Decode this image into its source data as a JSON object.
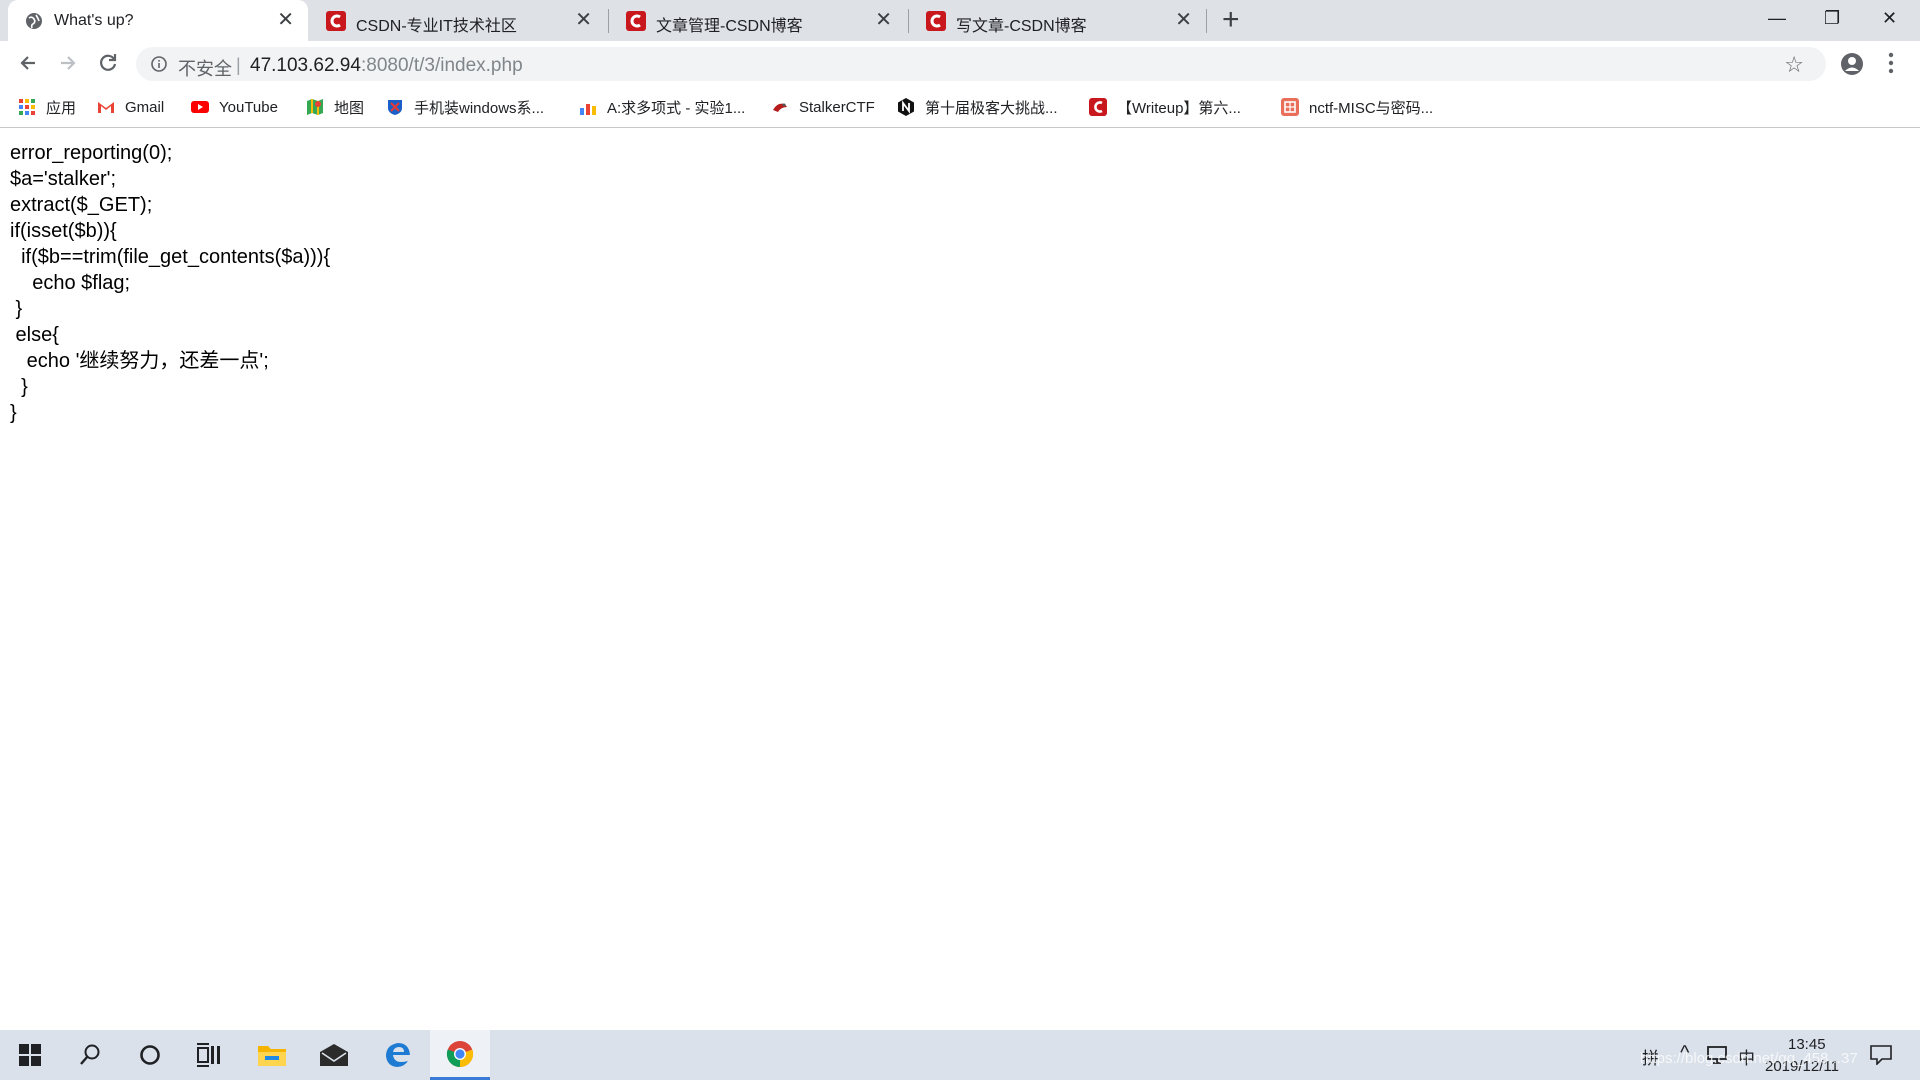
{
  "browser": {
    "tabs": [
      {
        "title": "What's up?",
        "icon": "globe-icon",
        "active": true
      },
      {
        "title": "CSDN-专业IT技术社区",
        "icon": "csdn-icon",
        "active": false
      },
      {
        "title": "文章管理-CSDN博客",
        "icon": "csdn-icon",
        "active": false
      },
      {
        "title": "写文章-CSDN博客",
        "icon": "csdn-icon",
        "active": false
      }
    ],
    "tab_close_glyph": "✕",
    "new_tab_glyph": "+",
    "window_controls": {
      "minimize": "—",
      "maximize": "❐",
      "close": "✕"
    },
    "address": {
      "security_label": "不安全",
      "separator": "|",
      "host": "47.103.62.94",
      "rest": ":8080/t/3/index.php"
    },
    "bookmark_star_glyph": "☆",
    "bookmarks": [
      {
        "label": "应用",
        "icon": "apps-grid-icon"
      },
      {
        "label": "Gmail",
        "icon": "gmail-icon"
      },
      {
        "label": "YouTube",
        "icon": "youtube-icon"
      },
      {
        "label": "地图",
        "icon": "maps-icon"
      },
      {
        "label": "手机装windows系...",
        "icon": "shield-bookmark-icon"
      },
      {
        "label": "A:求多项式 - 实验1...",
        "icon": "chart-bookmark-icon"
      },
      {
        "label": "StalkerCTF",
        "icon": "stalker-icon"
      },
      {
        "label": "第十届极客大挑战...",
        "icon": "n-logo-icon"
      },
      {
        "label": "【Writeup】第六...",
        "icon": "csdn-icon"
      },
      {
        "label": "nctf-MISC与密码...",
        "icon": "jianshu-icon"
      }
    ]
  },
  "page": {
    "code_lines": [
      "error_reporting(0);",
      "$a='stalker';",
      "extract($_GET);",
      "if(isset($b)){",
      "  if($b==trim(file_get_contents($a))){",
      "    echo $flag;",
      " }",
      " else{",
      "   echo '继续努力，还差一点';",
      "  }",
      "}"
    ]
  },
  "taskbar": {
    "tray": {
      "ime_mode": "拼",
      "caret": "^",
      "language": "中"
    },
    "clock": {
      "time": "13:45",
      "date": "2019/12/11"
    },
    "watermark": "https://blog.csdn.net/qq_458...37"
  },
  "colors": {
    "csdn_red": "#c9171e",
    "chrome_tab_bg": "#dee1e6",
    "taskbar_bg": "#dae1ea",
    "taskbar_active_accent": "#3a7bd5"
  }
}
